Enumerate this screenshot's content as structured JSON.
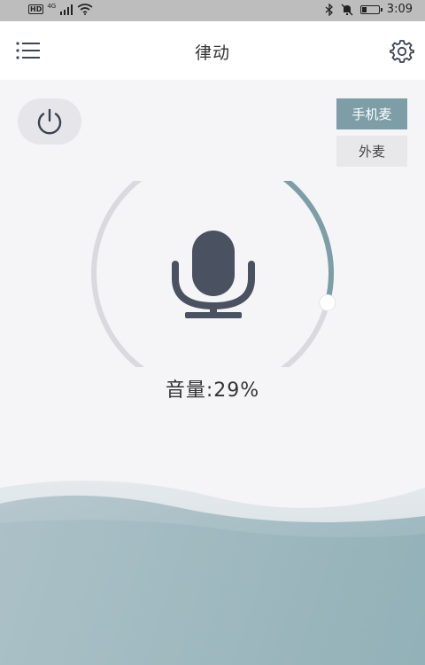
{
  "status_bar": {
    "left_icons": [
      "hd-icon",
      "signal-icon",
      "wifi-icon"
    ],
    "hd_text": "HD",
    "network_text": "4G",
    "right_icons": [
      "bluetooth-icon",
      "mute-icon",
      "battery-icon"
    ],
    "battery_level": 0.35,
    "time": "3:09"
  },
  "app_bar": {
    "title": "律动",
    "menu_icon": "menu-icon",
    "settings_icon": "gear-icon"
  },
  "power_button": {
    "icon": "power-icon"
  },
  "mic_sources": {
    "phone_label": "手机麦",
    "external_label": "外麦",
    "selected": "手机麦"
  },
  "volume": {
    "label": "音量:29%",
    "percent": 29
  },
  "colors": {
    "accent": "#7d9ea6",
    "ring_track": "#d9d9de",
    "mic_icon": "#4a5160",
    "background": "#f5f5f8"
  }
}
